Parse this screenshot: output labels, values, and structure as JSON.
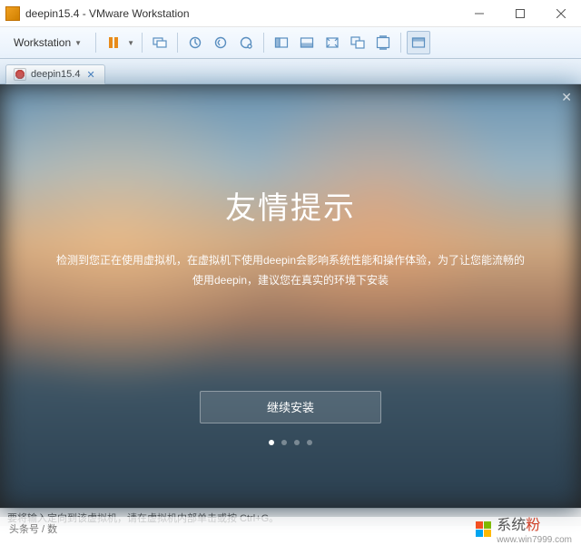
{
  "window": {
    "title": "deepin15.4 - VMware Workstation"
  },
  "toolbar": {
    "menu_label": "Workstation"
  },
  "tab": {
    "label": "deepin15.4"
  },
  "dialog": {
    "heading": "友情提示",
    "description": "检测到您正在使用虚拟机，在虚拟机下使用deepin会影响系统性能和操作体验，为了让您能流畅的使用deepin，建议您在真实的环境下安装",
    "continue_label": "继续安装"
  },
  "statusbar": {
    "text": "要将输入定向到该虚拟机，请在虚拟机内部单击或按 Ctrl+G。"
  },
  "overlay": {
    "left": "头条号 / 数",
    "brand_a": "系统",
    "brand_b": "粉",
    "url": "www.win7999.com"
  }
}
